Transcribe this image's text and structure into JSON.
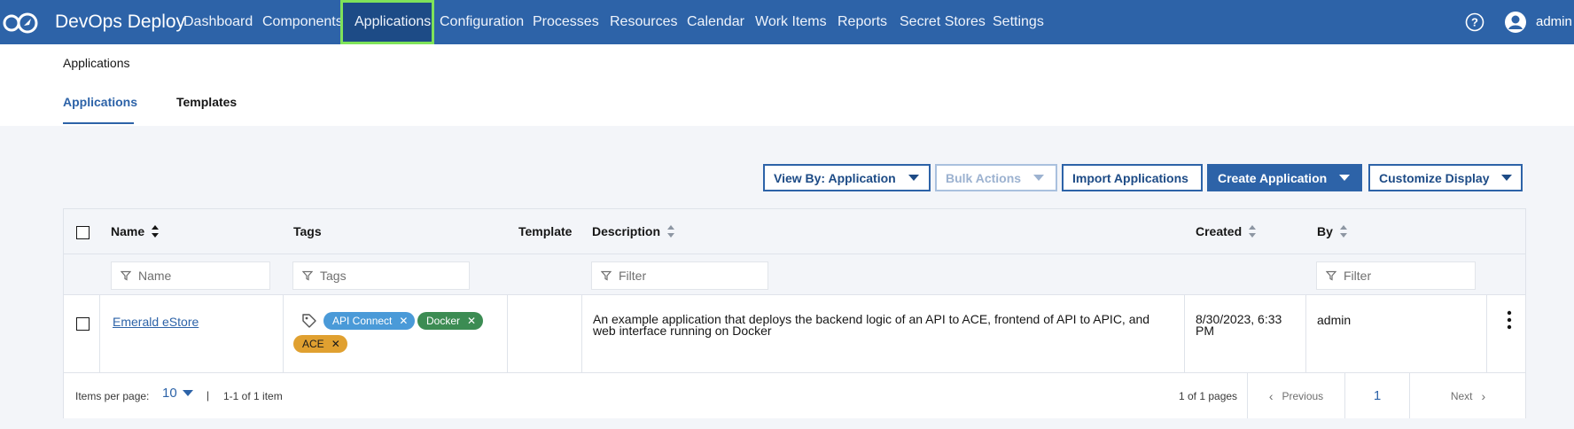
{
  "nav": {
    "brand": "DevOps Deploy",
    "items": [
      {
        "label": "Dashboard"
      },
      {
        "label": "Components"
      },
      {
        "label": "Applications"
      },
      {
        "label": "Configuration"
      },
      {
        "label": "Processes"
      },
      {
        "label": "Resources"
      },
      {
        "label": "Calendar"
      },
      {
        "label": "Work Items"
      },
      {
        "label": "Reports"
      },
      {
        "label": "Secret Stores"
      },
      {
        "label": "Settings"
      }
    ],
    "active": "Applications",
    "user": "admin",
    "icons": [
      "logo-icon",
      "help-icon",
      "user-icon"
    ],
    "accent_color": "#2d63a8",
    "highlight_color": "#7fe35a"
  },
  "header": {
    "breadcrumb": "Applications",
    "tabs": [
      {
        "label": "Applications"
      },
      {
        "label": "Templates"
      }
    ]
  },
  "toolbar": {
    "view_by": "View By: Application",
    "bulk_actions": "Bulk Actions",
    "import": "Import Applications",
    "create": "Create Application",
    "customize": "Customize Display"
  },
  "table": {
    "columns": {
      "name": "Name",
      "tags": "Tags",
      "template": "Template",
      "description": "Description",
      "created": "Created",
      "by": "By"
    },
    "filters": {
      "name_placeholder": "Name",
      "tags_placeholder": "Tags",
      "description_placeholder": "Filter",
      "by_placeholder": "Filter"
    },
    "rows": [
      {
        "name": "Emerald eStore",
        "tags": [
          {
            "label": "API Connect",
            "color": "#4a9ad8"
          },
          {
            "label": "Docker",
            "color": "#3c8c53"
          },
          {
            "label": "ACE",
            "color": "#e0a030"
          }
        ],
        "template": "",
        "description_line1": "An example application that deploys the backend logic of an API to ACE, frontend of API to APIC, and",
        "description_line2": "web interface running on Docker",
        "created_line1": "8/30/2023, 6:33",
        "created_line2": "PM",
        "by": "admin"
      }
    ]
  },
  "pagination": {
    "items_per_page_label": "Items per page:",
    "items_per_page": "10",
    "separator": "|",
    "range": "1-1 of 1 item",
    "pages": "1 of 1 pages",
    "previous": "Previous",
    "current_page": "1",
    "next": "Next"
  }
}
